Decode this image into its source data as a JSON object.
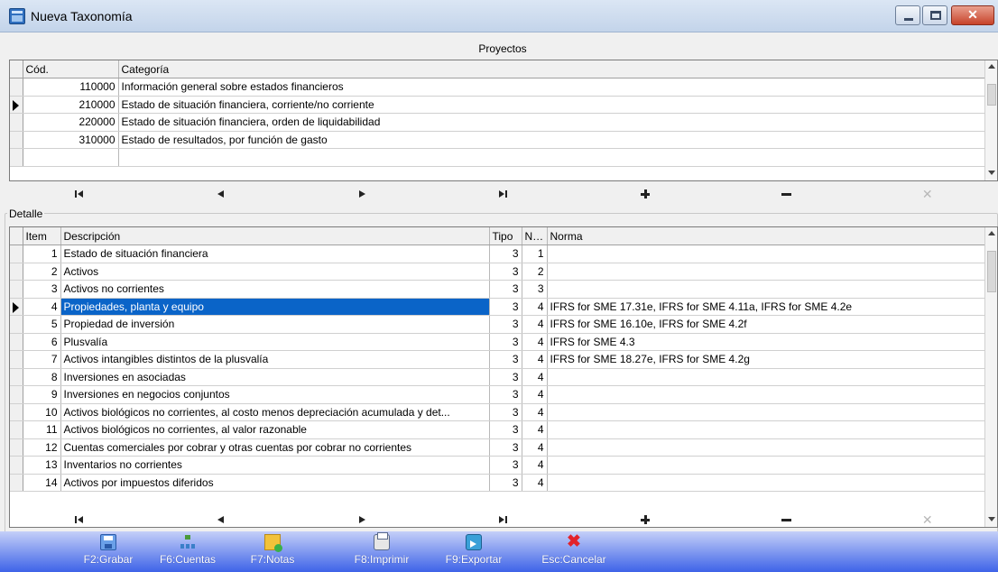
{
  "window": {
    "title": "Nueva Taxonomía"
  },
  "proyectos": {
    "title": "Proyectos",
    "columns": [
      "Cód.",
      "Categoría"
    ],
    "rows": [
      {
        "cod": "110000",
        "categoria": "Información general sobre estados financieros"
      },
      {
        "cod": "210000",
        "categoria": "Estado de situación financiera, corriente/no corriente"
      },
      {
        "cod": "220000",
        "categoria": "Estado de situación financiera, orden de liquidabilidad"
      },
      {
        "cod": "310000",
        "categoria": "Estado de resultados, por función de gasto"
      }
    ],
    "current_row_index": 1
  },
  "detalle": {
    "title": "Detalle",
    "columns": [
      "Item",
      "Descripción",
      "Tipo",
      "Nive",
      "Norma"
    ],
    "rows": [
      {
        "item": "1",
        "descripcion": "Estado de situación financiera",
        "tipo": "3",
        "nivel": "1",
        "norma": ""
      },
      {
        "item": "2",
        "descripcion": "Activos",
        "tipo": "3",
        "nivel": "2",
        "norma": ""
      },
      {
        "item": "3",
        "descripcion": "Activos no corrientes",
        "tipo": "3",
        "nivel": "3",
        "norma": ""
      },
      {
        "item": "4",
        "descripcion": "Propiedades, planta y equipo",
        "tipo": "3",
        "nivel": "4",
        "norma": "IFRS for SME 17.31e, IFRS for SME 4.11a, IFRS for SME 4.2e"
      },
      {
        "item": "5",
        "descripcion": "Propiedad de inversión",
        "tipo": "3",
        "nivel": "4",
        "norma": "IFRS for SME 16.10e, IFRS for SME 4.2f"
      },
      {
        "item": "6",
        "descripcion": "Plusvalía",
        "tipo": "3",
        "nivel": "4",
        "norma": "IFRS for SME 4.3"
      },
      {
        "item": "7",
        "descripcion": "Activos intangibles distintos de la plusvalía",
        "tipo": "3",
        "nivel": "4",
        "norma": "IFRS for SME 18.27e, IFRS for SME 4.2g"
      },
      {
        "item": "8",
        "descripcion": "Inversiones en asociadas",
        "tipo": "3",
        "nivel": "4",
        "norma": ""
      },
      {
        "item": "9",
        "descripcion": "Inversiones en negocios conjuntos",
        "tipo": "3",
        "nivel": "4",
        "norma": ""
      },
      {
        "item": "10",
        "descripcion": "Activos biológicos no corrientes, al costo menos depreciación acumulada y det...",
        "tipo": "3",
        "nivel": "4",
        "norma": ""
      },
      {
        "item": "11",
        "descripcion": "Activos biológicos no corrientes, al valor razonable",
        "tipo": "3",
        "nivel": "4",
        "norma": ""
      },
      {
        "item": "12",
        "descripcion": "Cuentas comerciales por cobrar y otras cuentas por cobrar no corrientes",
        "tipo": "3",
        "nivel": "4",
        "norma": ""
      },
      {
        "item": "13",
        "descripcion": "Inventarios no corrientes",
        "tipo": "3",
        "nivel": "4",
        "norma": ""
      },
      {
        "item": "14",
        "descripcion": "Activos por impuestos diferidos",
        "tipo": "3",
        "nivel": "4",
        "norma": ""
      }
    ],
    "current_row_index": 3
  },
  "navigator_icons": [
    "first-icon",
    "prior-icon",
    "next-icon",
    "last-icon",
    "insert-icon",
    "delete-icon",
    "cancel-edit-icon"
  ],
  "toolbar": [
    {
      "label": "F2:Grabar",
      "icon": "save-icon"
    },
    {
      "label": "F6:Cuentas",
      "icon": "accounts-tree-icon"
    },
    {
      "label": "F7:Notas",
      "icon": "notes-icon"
    },
    {
      "label": "F8:Imprimir",
      "icon": "printer-icon"
    },
    {
      "label": "F9:Exportar",
      "icon": "export-icon"
    },
    {
      "label": "Esc:Cancelar",
      "icon": "cancel-x-icon"
    }
  ],
  "colors": {
    "selection": "#0a64c8",
    "toolbar_top": "#c4cff8",
    "toolbar_bottom": "#3e63e8",
    "cancel_red": "#e2222a"
  }
}
